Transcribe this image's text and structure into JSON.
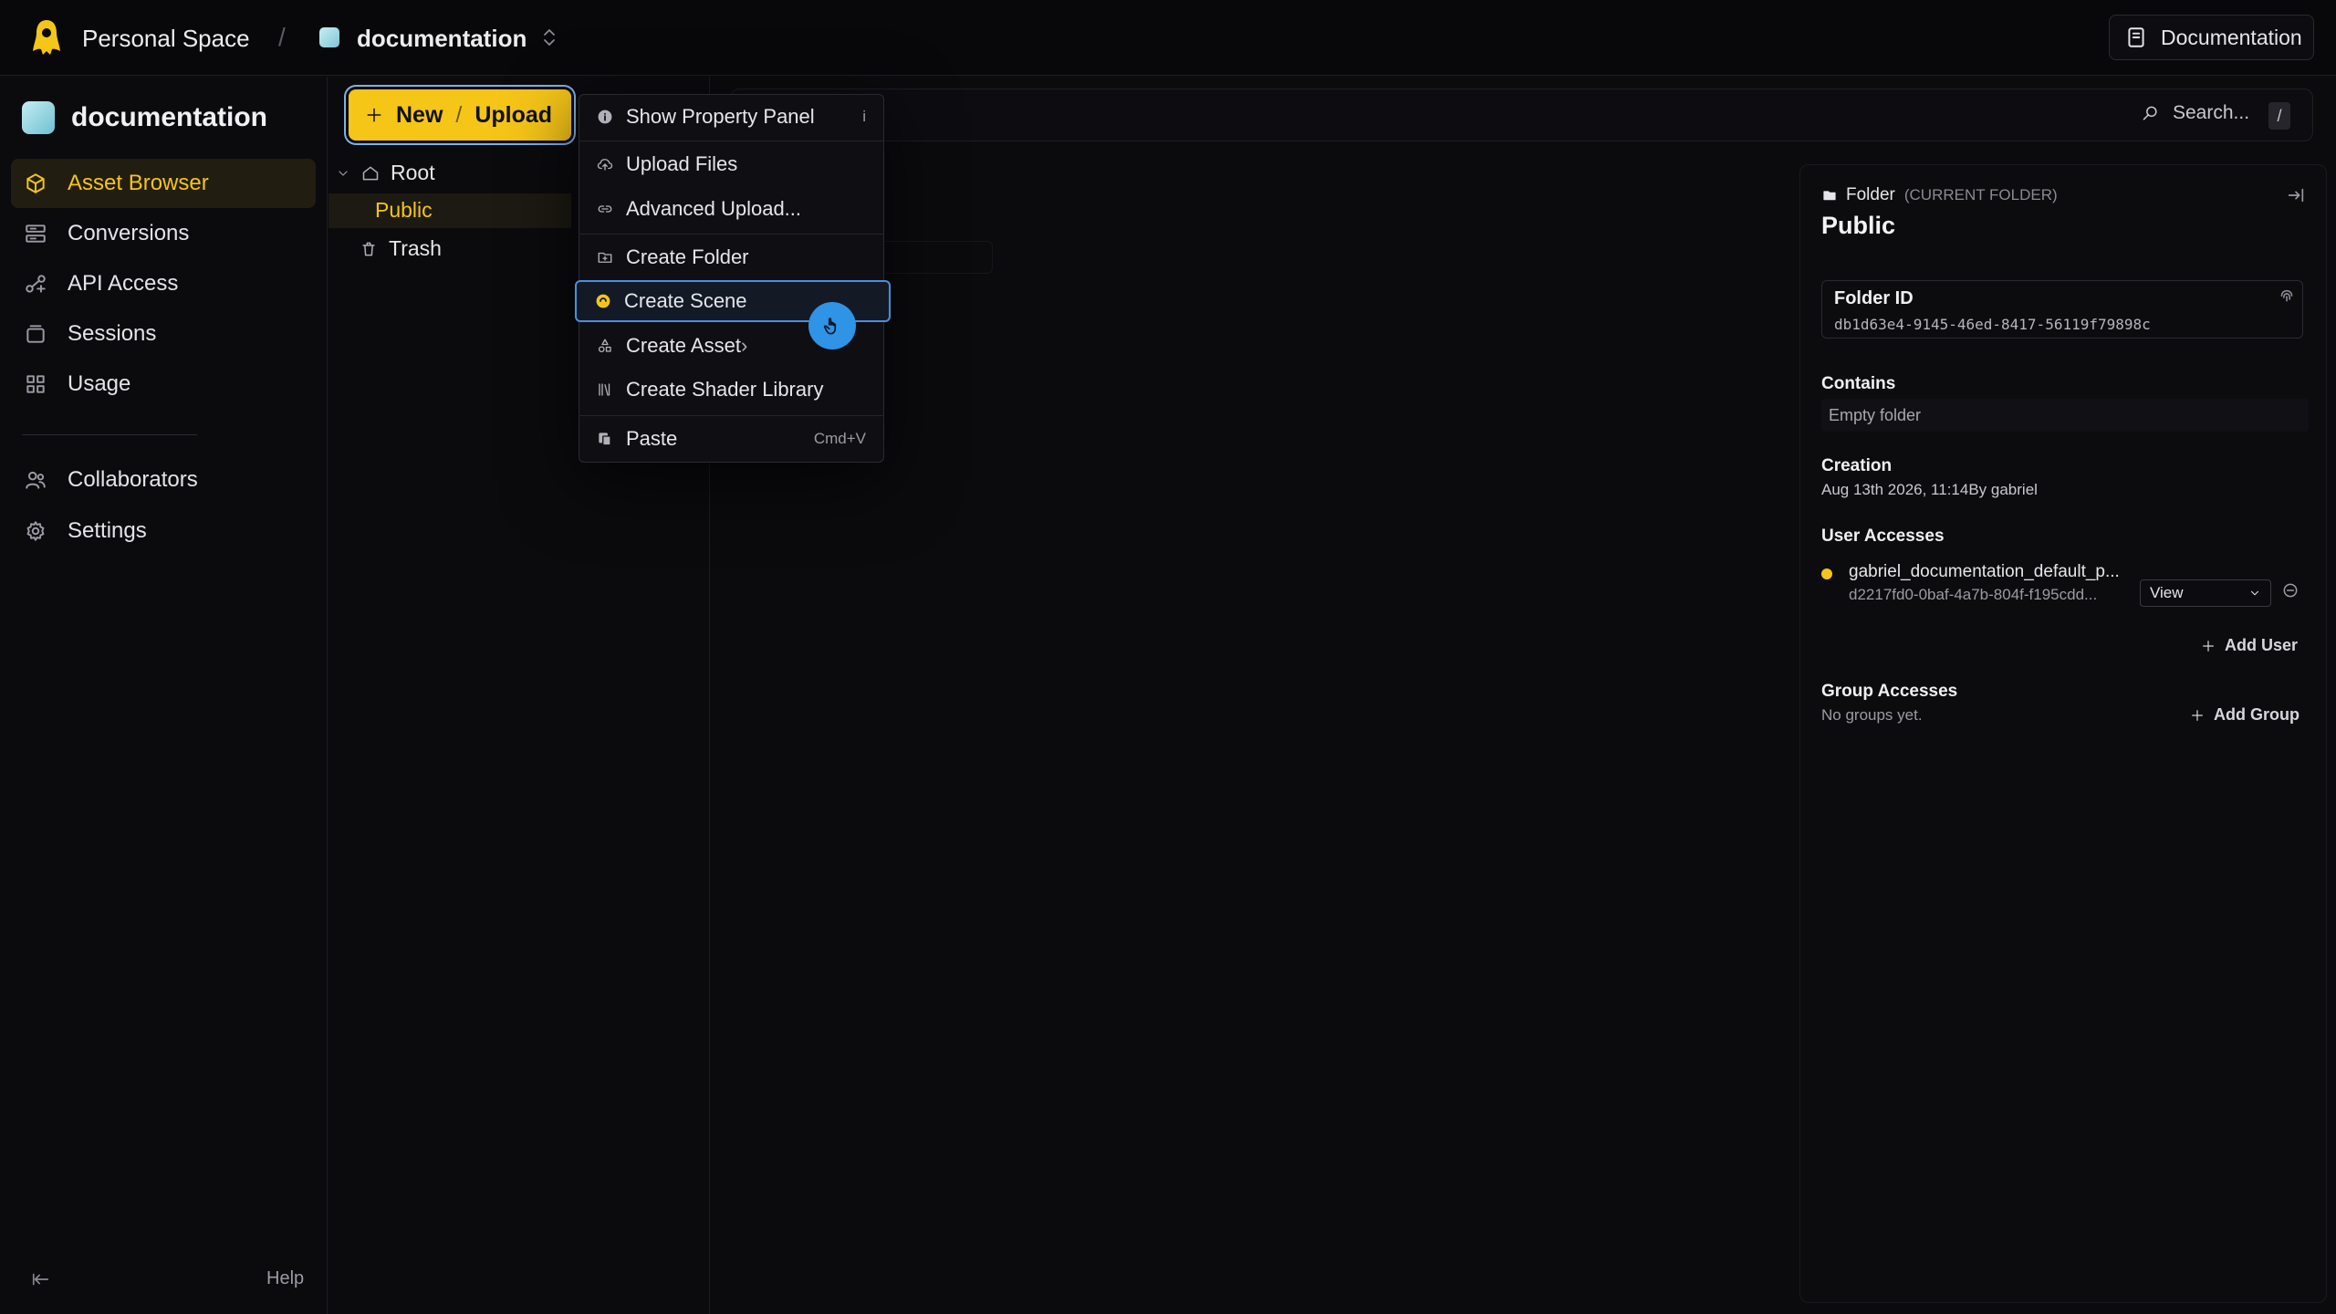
{
  "topbar": {
    "space": "Personal Space",
    "separator": "/",
    "project": "documentation",
    "docs_button": "Documentation"
  },
  "sidebar": {
    "project_name": "documentation",
    "items": [
      {
        "label": "Asset Browser",
        "icon": "cube-icon",
        "active": true
      },
      {
        "label": "Conversions",
        "icon": "conversions-icon"
      },
      {
        "label": "API Access",
        "icon": "api-icon"
      },
      {
        "label": "Sessions",
        "icon": "sessions-icon"
      },
      {
        "label": "Usage",
        "icon": "usage-icon"
      },
      {
        "label": "Collaborators",
        "icon": "users-icon"
      },
      {
        "label": "Settings",
        "icon": "gear-icon"
      }
    ],
    "help": "Help"
  },
  "toolbar": {
    "new_label": "New",
    "slash": "/",
    "upload_label": "Upload",
    "search_placeholder": "Search...",
    "search_shortcut": "/"
  },
  "tree": {
    "root": "Root",
    "public": "Public",
    "trash": "Trash"
  },
  "menu": {
    "items": [
      {
        "label": "Show Property Panel",
        "shortcut": "i"
      },
      {
        "label": "Upload Files"
      },
      {
        "label": "Advanced Upload..."
      },
      {
        "label": "Create Folder"
      },
      {
        "label": "Create Scene"
      },
      {
        "label": "Create Asset",
        "submenu": "›"
      },
      {
        "label": "Create Shader Library"
      },
      {
        "label": "Paste",
        "shortcut": "Cmd+V"
      }
    ]
  },
  "panel": {
    "folder_label": "Folder",
    "current_folder": "(CURRENT FOLDER)",
    "title": "Public",
    "folder_id_label": "Folder ID",
    "folder_id": "db1d63e4-9145-46ed-8417-56119f79898c",
    "contains_label": "Contains",
    "contains_value": "Empty folder",
    "creation_label": "Creation",
    "creation_value": "Aug 13th 2026, 11:14By gabriel",
    "user_accesses_label": "User Accesses",
    "user_name": "gabriel_documentation_default_p...",
    "user_id": "d2217fd0-0baf-4a7b-804f-f195cdd...",
    "user_role": "View",
    "add_user": "Add User",
    "group_accesses_label": "Group Accesses",
    "no_groups": "No groups yet.",
    "add_group": "Add Group"
  },
  "colors": {
    "accent": "#f5c518",
    "highlight": "#4a8fe0",
    "background": "#0b0b0e"
  }
}
